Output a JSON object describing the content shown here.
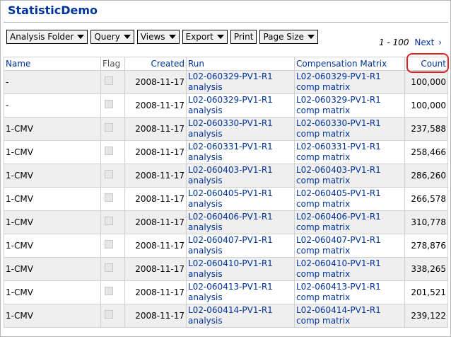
{
  "page": {
    "title": "StatisticDemo"
  },
  "toolbar": {
    "analysis_folder": "Analysis Folder",
    "query": "Query",
    "views": "Views",
    "export": "Export",
    "print": "Print",
    "page_size": "Page Size"
  },
  "pager": {
    "range": "1 - 100",
    "next": "Next",
    "chevron": "›"
  },
  "columns": {
    "name": "Name",
    "flag": "Flag",
    "created": "Created",
    "run": "Run",
    "comp_matrix": "Compensation Matrix",
    "count": "Count"
  },
  "rows": [
    {
      "name": "-",
      "created": "2008-11-17",
      "run": "L02-060329-PV1-R1 analysis",
      "comp": "L02-060329-PV1-R1 comp matrix",
      "count": "100,000"
    },
    {
      "name": "-",
      "created": "2008-11-17",
      "run": "L02-060329-PV1-R1 analysis",
      "comp": "L02-060329-PV1-R1 comp matrix",
      "count": "100,000"
    },
    {
      "name": "1-CMV",
      "created": "2008-11-17",
      "run": "L02-060330-PV1-R1 analysis",
      "comp": "L02-060330-PV1-R1 comp matrix",
      "count": "237,588"
    },
    {
      "name": "1-CMV",
      "created": "2008-11-17",
      "run": "L02-060331-PV1-R1 analysis",
      "comp": "L02-060331-PV1-R1 comp matrix",
      "count": "258,466"
    },
    {
      "name": "1-CMV",
      "created": "2008-11-17",
      "run": "L02-060403-PV1-R1 analysis",
      "comp": "L02-060403-PV1-R1 comp matrix",
      "count": "286,260"
    },
    {
      "name": "1-CMV",
      "created": "2008-11-17",
      "run": "L02-060405-PV1-R1 analysis",
      "comp": "L02-060405-PV1-R1 comp matrix",
      "count": "266,578"
    },
    {
      "name": "1-CMV",
      "created": "2008-11-17",
      "run": "L02-060406-PV1-R1 analysis",
      "comp": "L02-060406-PV1-R1 comp matrix",
      "count": "310,778"
    },
    {
      "name": "1-CMV",
      "created": "2008-11-17",
      "run": "L02-060407-PV1-R1 analysis",
      "comp": "L02-060407-PV1-R1 comp matrix",
      "count": "278,876"
    },
    {
      "name": "1-CMV",
      "created": "2008-11-17",
      "run": "L02-060410-PV1-R1 analysis",
      "comp": "L02-060410-PV1-R1 comp matrix",
      "count": "338,265"
    },
    {
      "name": "1-CMV",
      "created": "2008-11-17",
      "run": "L02-060413-PV1-R1 analysis",
      "comp": "L02-060413-PV1-R1 comp matrix",
      "count": "201,521"
    },
    {
      "name": "1-CMV",
      "created": "2008-11-17",
      "run": "L02-060414-PV1-R1 analysis",
      "comp": "L02-060414-PV1-R1 comp matrix",
      "count": "239,122"
    }
  ],
  "colors": {
    "link": "#003399",
    "row_alt": "#efefef",
    "highlight": "#e02020"
  }
}
